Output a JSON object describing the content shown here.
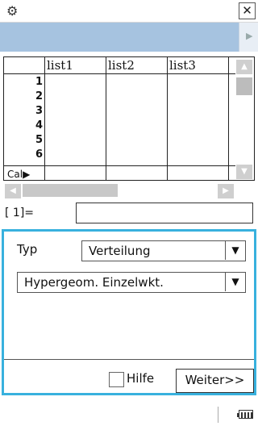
{
  "window": {
    "settings_icon": "gear-icon",
    "close_glyph": "✕"
  },
  "sheet": {
    "columns": [
      "list1",
      "list2",
      "list3"
    ],
    "row_numbers": [
      "1",
      "2",
      "3",
      "4",
      "5",
      "6"
    ],
    "calc_row_label": "Cal▶"
  },
  "entry": {
    "cell_ref": "[  1]=",
    "value": ""
  },
  "dialog": {
    "type_label": "Typ",
    "type_value": "Verteilung",
    "distribution_value": "Hypergeom. Einzelwkt.",
    "help_label": "Hilfe",
    "help_checked": false,
    "next_label": "Weiter>>"
  },
  "colors": {
    "toolbar": "#a6c3e0",
    "dialog_border": "#38b1de"
  }
}
